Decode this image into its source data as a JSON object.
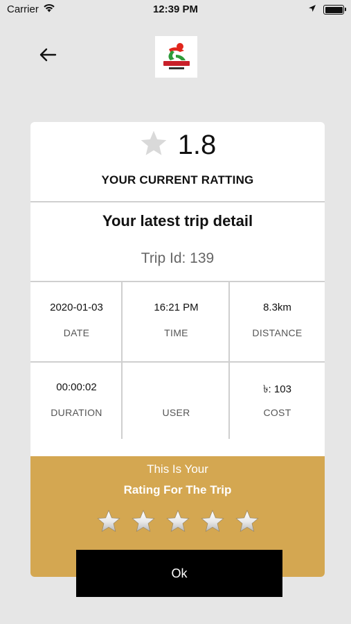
{
  "status_bar": {
    "carrier": "Carrier",
    "time": "12:39 PM",
    "icons": [
      "wifi-icon",
      "location-arrow-icon",
      "battery-icon"
    ]
  },
  "header": {
    "back_icon": "back-arrow-icon",
    "logo": "app-logo"
  },
  "rating": {
    "value": "1.8",
    "caption": "YOUR CURRENT RATTING",
    "star_color": "#d9d9d9"
  },
  "trip": {
    "title": "Your latest trip detail",
    "id_text": "Trip Id: 139"
  },
  "details": [
    {
      "value": "2020-01-03",
      "label": "DATE"
    },
    {
      "value": "16:21 PM",
      "label": "TIME"
    },
    {
      "value": "8.3km",
      "label": "DISTANCE"
    },
    {
      "value": "00:00:02",
      "label": "DURATION"
    },
    {
      "value": "",
      "label": "USER"
    },
    {
      "value": "৳: 103",
      "label": "COST"
    }
  ],
  "rate_panel": {
    "line1": "This Is Your",
    "line2": "Rating For The Trip",
    "background": "#d4a751",
    "star_count": 5
  },
  "ok_button": {
    "label": "Ok"
  }
}
